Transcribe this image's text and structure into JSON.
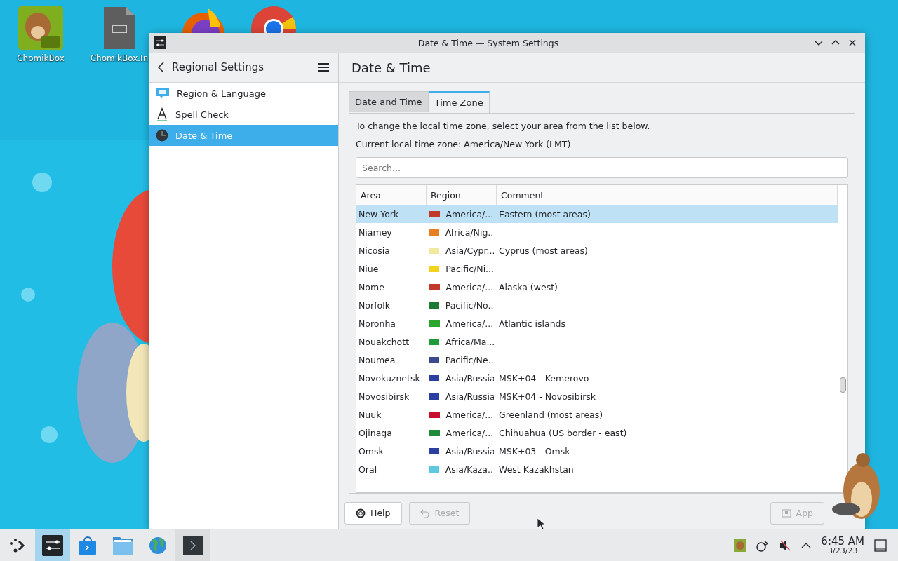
{
  "desktop": {
    "icons": [
      {
        "kind": "app",
        "label": "ChomikBox"
      },
      {
        "kind": "file",
        "label": "ChomikBox.In"
      },
      {
        "kind": "firefox"
      },
      {
        "kind": "chrome"
      }
    ]
  },
  "window": {
    "title": "Date & Time — System Settings",
    "sidebar": {
      "title": "Regional Settings",
      "items": [
        {
          "kind": "region",
          "label": "Region & Language",
          "selected": false
        },
        {
          "kind": "spell",
          "label": "Spell Check",
          "selected": false
        },
        {
          "kind": "clock",
          "label": "Date & Time",
          "selected": true
        }
      ]
    },
    "page_title": "Date & Time",
    "tabs": [
      {
        "label": "Date and Time",
        "selected": false
      },
      {
        "label": "Time Zone",
        "selected": true
      }
    ],
    "instructions": "To change the local time zone, select your area from the list below.",
    "current_zone": "Current local time zone: America/New York (LMT)",
    "search": {
      "placeholder": "Search..."
    },
    "table": {
      "columns": [
        "Area",
        "Region",
        "Comment"
      ],
      "rows": [
        {
          "area": "New York",
          "color": "#c0392b",
          "region": "America/...",
          "comment": "Eastern (most areas)",
          "selected": true
        },
        {
          "area": "Niamey",
          "color": "#e67e22",
          "region": "Africa/Nig...",
          "selected": false
        },
        {
          "area": "Nicosia",
          "color": "#f1e9a0",
          "region": "Asia/Cypr...",
          "comment": "Cyprus (most areas)",
          "selected": false
        },
        {
          "area": "Niue",
          "color": "#f2d21b",
          "region": "Pacific/Ni...",
          "selected": false
        },
        {
          "area": "Nome",
          "color": "#c0392b",
          "region": "America/...",
          "comment": "Alaska (west)",
          "selected": false
        },
        {
          "area": "Norfolk",
          "color": "#1e7b34",
          "region": "Pacific/No...",
          "selected": false
        },
        {
          "area": "Noronha",
          "color": "#2aa52e",
          "region": "America/...",
          "comment": "Atlantic islands",
          "selected": false
        },
        {
          "area": "Nouakchott",
          "color": "#1f9a3a",
          "region": "Africa/Ma...",
          "selected": false
        },
        {
          "area": "Noumea",
          "color": "#3a4a8a",
          "region": "Pacific/Ne...",
          "selected": false
        },
        {
          "area": "Novokuznetsk",
          "color": "#2a3fa0",
          "region": "Asia/Russia",
          "comment": "MSK+04 - Kemerovo",
          "selected": false
        },
        {
          "area": "Novosibirsk",
          "color": "#2a3fa0",
          "region": "Asia/Russia",
          "comment": "MSK+04 - Novosibirsk",
          "selected": false
        },
        {
          "area": "Nuuk",
          "color": "#c8102e",
          "region": "America/...",
          "comment": "Greenland (most areas)",
          "selected": false
        },
        {
          "area": "Ojinaga",
          "color": "#1f8a3a",
          "region": "America/...",
          "comment": "Chihuahua (US border - east)",
          "selected": false
        },
        {
          "area": "Omsk",
          "color": "#2a3fa0",
          "region": "Asia/Russia",
          "comment": "MSK+03 - Omsk",
          "selected": false
        },
        {
          "area": "Oral",
          "color": "#5ec8e0",
          "region": "Asia/Kaza...",
          "comment": "West Kazakhstan",
          "selected": false
        }
      ]
    },
    "buttons": [
      {
        "kind": "help",
        "label": "Help",
        "disabled": false
      },
      {
        "kind": "reset",
        "label": "Reset",
        "disabled": true
      },
      {
        "kind": "apply",
        "label": "App",
        "disabled": true
      }
    ]
  },
  "taskbar": {
    "tasks": [
      {
        "kind": "launcher",
        "selected": false
      },
      {
        "kind": "settings",
        "selected": true
      },
      {
        "kind": "store",
        "selected": false
      },
      {
        "kind": "folder",
        "selected": false
      },
      {
        "kind": "globe",
        "selected": false
      },
      {
        "kind": "terminal",
        "selected": false
      }
    ],
    "tray": {
      "time": "6:45 AM",
      "date": "3/23/23"
    }
  }
}
